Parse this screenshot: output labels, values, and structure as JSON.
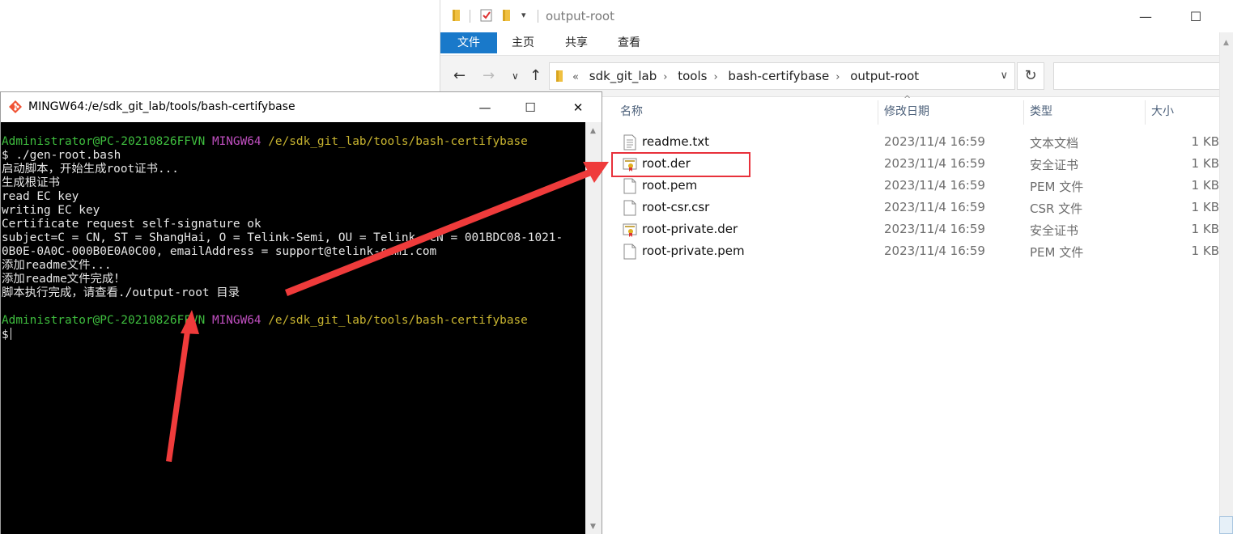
{
  "explorer": {
    "title": "output-root",
    "ribbon_tabs": [
      "文件",
      "主页",
      "共享",
      "查看"
    ],
    "breadcrumb_prefix": "«",
    "breadcrumb": [
      "sdk_git_lab",
      "tools",
      "bash-certifybase",
      "output-root"
    ],
    "columns": {
      "name": "名称",
      "date": "修改日期",
      "type": "类型",
      "size": "大小"
    },
    "files": [
      {
        "name": "readme.txt",
        "date": "2023/11/4 16:59",
        "type": "文本文档",
        "size": "1 KB",
        "icon": "text-file-icon"
      },
      {
        "name": "root.der",
        "date": "2023/11/4 16:59",
        "type": "安全证书",
        "size": "1 KB",
        "icon": "certificate-icon"
      },
      {
        "name": "root.pem",
        "date": "2023/11/4 16:59",
        "type": "PEM 文件",
        "size": "1 KB",
        "icon": "file-icon"
      },
      {
        "name": "root-csr.csr",
        "date": "2023/11/4 16:59",
        "type": "CSR 文件",
        "size": "1 KB",
        "icon": "file-icon"
      },
      {
        "name": "root-private.der",
        "date": "2023/11/4 16:59",
        "type": "安全证书",
        "size": "1 KB",
        "icon": "certificate-icon"
      },
      {
        "name": "root-private.pem",
        "date": "2023/11/4 16:59",
        "type": "PEM 文件",
        "size": "1 KB",
        "icon": "file-icon"
      }
    ],
    "window_buttons": {
      "minimize": "—",
      "maximize": "☐"
    }
  },
  "terminal": {
    "title": "MINGW64:/e/sdk_git_lab/tools/bash-certifybase",
    "window_buttons": {
      "minimize": "—",
      "maximize": "☐",
      "close": "✕"
    },
    "prompt": {
      "user": "Administrator@PC-20210826FFVN",
      "env": "MINGW64",
      "path": "/e/sdk_git_lab/tools/bash-certifybase",
      "symbol": "$"
    },
    "command": "./gen-root.bash",
    "output": [
      "启动脚本，开始生成root证书...",
      "生成根证书",
      "read EC key",
      "writing EC key",
      "Certificate request self-signature ok",
      "subject=C = CN, ST = ShangHai, O = Telink-Semi, OU = Telink, CN = 001BDC08-1021-",
      "0B0E-0A0C-000B0E0A0C00, emailAddress = support@telink-semi.com",
      "添加readme文件...",
      "添加readme文件完成！",
      "脚本执行完成，请查看./output-root 目录"
    ]
  },
  "colors": {
    "highlight": "#e8313b",
    "arrow": "#ef3b3b",
    "ribbon_file_tab": "#1979ca",
    "prompt_user": "#3fbf3f",
    "prompt_env": "#c04fc0",
    "prompt_path": "#c8b430"
  }
}
